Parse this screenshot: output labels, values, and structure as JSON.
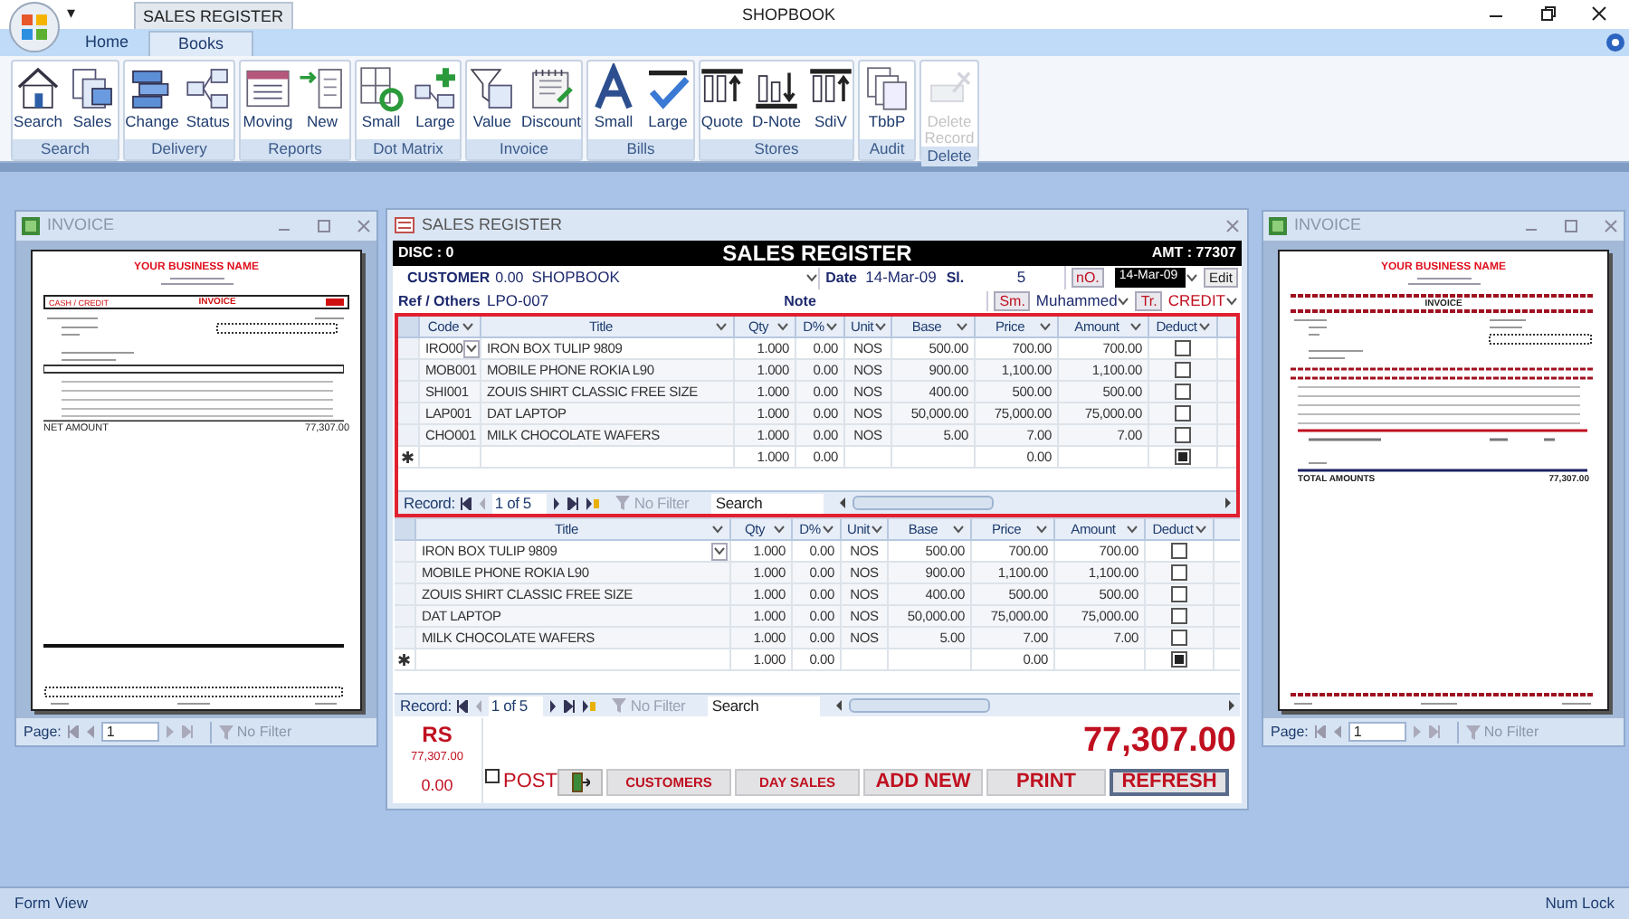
{
  "app": {
    "title": "SHOPBOOK",
    "context_tab": "SALES REGISTER",
    "quick_access": "▾"
  },
  "tabs": [
    {
      "label": "Home",
      "selected": false
    },
    {
      "label": "Books",
      "selected": true
    }
  ],
  "ribbon_groups": [
    {
      "label": "Search",
      "buttons": [
        {
          "label": "Search",
          "disabled": false
        },
        {
          "label": "Sales",
          "disabled": false
        }
      ]
    },
    {
      "label": "Delivery",
      "buttons": [
        {
          "label": "Change",
          "disabled": false
        },
        {
          "label": "Status",
          "disabled": false
        }
      ]
    },
    {
      "label": "Reports",
      "buttons": [
        {
          "label": "Moving",
          "disabled": false
        },
        {
          "label": "New",
          "disabled": false
        }
      ]
    },
    {
      "label": "Dot Matrix",
      "buttons": [
        {
          "label": "Small",
          "disabled": false
        },
        {
          "label": "Large",
          "disabled": false
        }
      ]
    },
    {
      "label": "Invoice",
      "buttons": [
        {
          "label": "Value",
          "disabled": false
        },
        {
          "label": "Discount",
          "disabled": false
        }
      ]
    },
    {
      "label": "Bills",
      "buttons": [
        {
          "label": "Small",
          "disabled": false
        },
        {
          "label": "Large",
          "disabled": false
        }
      ]
    },
    {
      "label": "Stores",
      "buttons": [
        {
          "label": "Quote",
          "disabled": false
        },
        {
          "label": "D-Note",
          "disabled": false
        },
        {
          "label": "SdiV",
          "disabled": false
        }
      ]
    },
    {
      "label": "Audit",
      "buttons": [
        {
          "label": "TbbP",
          "disabled": false
        }
      ]
    },
    {
      "label": "Delete",
      "buttons": [
        {
          "label": "Delete Record",
          "disabled": true
        }
      ]
    }
  ],
  "invoice_windows": [
    {
      "title": "INVOICE",
      "kind": "boxed",
      "business_name": "YOUR BUSINESS NAME",
      "type_label": "CASH / CREDIT",
      "heading": "INVOICE",
      "total_label": "NET AMOUNT",
      "total": "77,307.00",
      "page_label": "Page:",
      "page": "1",
      "filter": "No Filter"
    },
    {
      "title": "INVOICE",
      "kind": "dashed",
      "business_name": "YOUR BUSINESS NAME",
      "heading": "INVOICE",
      "total_label": "TOTAL AMOUNTS",
      "total": "77,307.00",
      "page_label": "Page:",
      "page": "1",
      "filter": "No Filter"
    }
  ],
  "register": {
    "title": "SALES REGISTER",
    "disc": "DISC : 0",
    "heading": "SALES REGISTER",
    "amt": "AMT : 77307",
    "customer": {
      "label": "CUSTOMER",
      "balance": "0.00",
      "value": "SHOPBOOK"
    },
    "date": {
      "label": "Date",
      "value": "14-Mar-09"
    },
    "serial": {
      "label": "Sl.",
      "value": "5"
    },
    "no_button": "nO.",
    "date_picker": "14-Mar-09",
    "edit_button": "Edit",
    "ref": {
      "label": "Ref / Others",
      "value": "LPO-007"
    },
    "note": {
      "label": "Note"
    },
    "salesman": {
      "button": "Sm.",
      "value": "Muhammed"
    },
    "transaction": {
      "button": "Tr.",
      "value": "CREDIT"
    },
    "grids": [
      {
        "columns": [
          {
            "label": "Code",
            "kind": "text"
          },
          {
            "label": "Title",
            "kind": "text"
          },
          {
            "label": "Qty",
            "kind": "number"
          },
          {
            "label": "D%",
            "kind": "number"
          },
          {
            "label": "Unit",
            "kind": "center"
          },
          {
            "label": "Base",
            "kind": "number"
          },
          {
            "label": "Price",
            "kind": "number"
          },
          {
            "label": "Amount",
            "kind": "number"
          },
          {
            "label": "Deduct",
            "kind": "check"
          }
        ],
        "rows": [
          {
            "cells": [
              "IRO00",
              "IRON BOX TULIP 9809",
              "1.000",
              "0.00",
              "NOS",
              "500.00",
              "700.00",
              "700.00"
            ],
            "deduct": false,
            "focused": true
          },
          {
            "cells": [
              "MOB001",
              "MOBILE PHONE ROKIA L90",
              "1.000",
              "0.00",
              "NOS",
              "900.00",
              "1,100.00",
              "1,100.00"
            ],
            "deduct": false,
            "focused": false
          },
          {
            "cells": [
              "SHI001",
              "ZOUIS SHIRT CLASSIC FREE SIZE",
              "1.000",
              "0.00",
              "NOS",
              "400.00",
              "500.00",
              "500.00"
            ],
            "deduct": false,
            "focused": false
          },
          {
            "cells": [
              "LAP001",
              "DAT LAPTOP",
              "1.000",
              "0.00",
              "NOS",
              "50,000.00",
              "75,000.00",
              "75,000.00"
            ],
            "deduct": false,
            "focused": false
          },
          {
            "cells": [
              "CHO001",
              "MILK CHOCOLATE WAFERS",
              "1.000",
              "0.00",
              "NOS",
              "5.00",
              "7.00",
              "7.00"
            ],
            "deduct": false,
            "focused": false
          }
        ],
        "new_row": {
          "marker": "✱",
          "cells": [
            "",
            "",
            "1.000",
            "0.00",
            "",
            "",
            "0.00",
            ""
          ],
          "deduct": true
        },
        "nav": {
          "label": "Record:",
          "position": "1 of 5",
          "filter": "No Filter",
          "search": "Search"
        }
      },
      {
        "columns": [
          {
            "label": "Title",
            "kind": "text"
          },
          {
            "label": "Qty",
            "kind": "number"
          },
          {
            "label": "D%",
            "kind": "number"
          },
          {
            "label": "Unit",
            "kind": "center"
          },
          {
            "label": "Base",
            "kind": "number"
          },
          {
            "label": "Price",
            "kind": "number"
          },
          {
            "label": "Amount",
            "kind": "number"
          },
          {
            "label": "Deduct",
            "kind": "check"
          }
        ],
        "rows": [
          {
            "cells": [
              "IRON BOX TULIP 9809",
              "1.000",
              "0.00",
              "NOS",
              "500.00",
              "700.00",
              "700.00"
            ],
            "deduct": false,
            "focused": true
          },
          {
            "cells": [
              "MOBILE PHONE ROKIA L90",
              "1.000",
              "0.00",
              "NOS",
              "900.00",
              "1,100.00",
              "1,100.00"
            ],
            "deduct": false,
            "focused": false
          },
          {
            "cells": [
              "ZOUIS SHIRT CLASSIC FREE SIZE",
              "1.000",
              "0.00",
              "NOS",
              "400.00",
              "500.00",
              "500.00"
            ],
            "deduct": false,
            "focused": false
          },
          {
            "cells": [
              "DAT LAPTOP",
              "1.000",
              "0.00",
              "NOS",
              "50,000.00",
              "75,000.00",
              "75,000.00"
            ],
            "deduct": false,
            "focused": false
          },
          {
            "cells": [
              "MILK CHOCOLATE WAFERS",
              "1.000",
              "0.00",
              "NOS",
              "5.00",
              "7.00",
              "7.00"
            ],
            "deduct": false,
            "focused": false
          }
        ],
        "new_row": {
          "marker": "✱",
          "cells": [
            "",
            "1.000",
            "0.00",
            "",
            "",
            "0.00",
            ""
          ],
          "deduct": true
        },
        "nav": {
          "label": "Record:",
          "position": "1 of 5",
          "filter": "No Filter",
          "search": "Search"
        }
      }
    ],
    "currency": "RS",
    "subtotal": "77,307.00",
    "balance": "0.00",
    "total": "77,307.00",
    "post": {
      "label": "POST",
      "checked": false
    },
    "buttons": [
      {
        "kind": "exit"
      },
      {
        "kind": "small",
        "label": "CUSTOMERS",
        "focused": false
      },
      {
        "kind": "small",
        "label": "DAY SALES",
        "focused": false
      },
      {
        "kind": "large",
        "label": "ADD NEW",
        "focused": false
      },
      {
        "kind": "large",
        "label": "PRINT",
        "focused": false
      },
      {
        "kind": "large",
        "label": "REFRESH",
        "focused": true
      }
    ]
  },
  "status_bar": {
    "left": "Form View",
    "right": "Num Lock"
  }
}
